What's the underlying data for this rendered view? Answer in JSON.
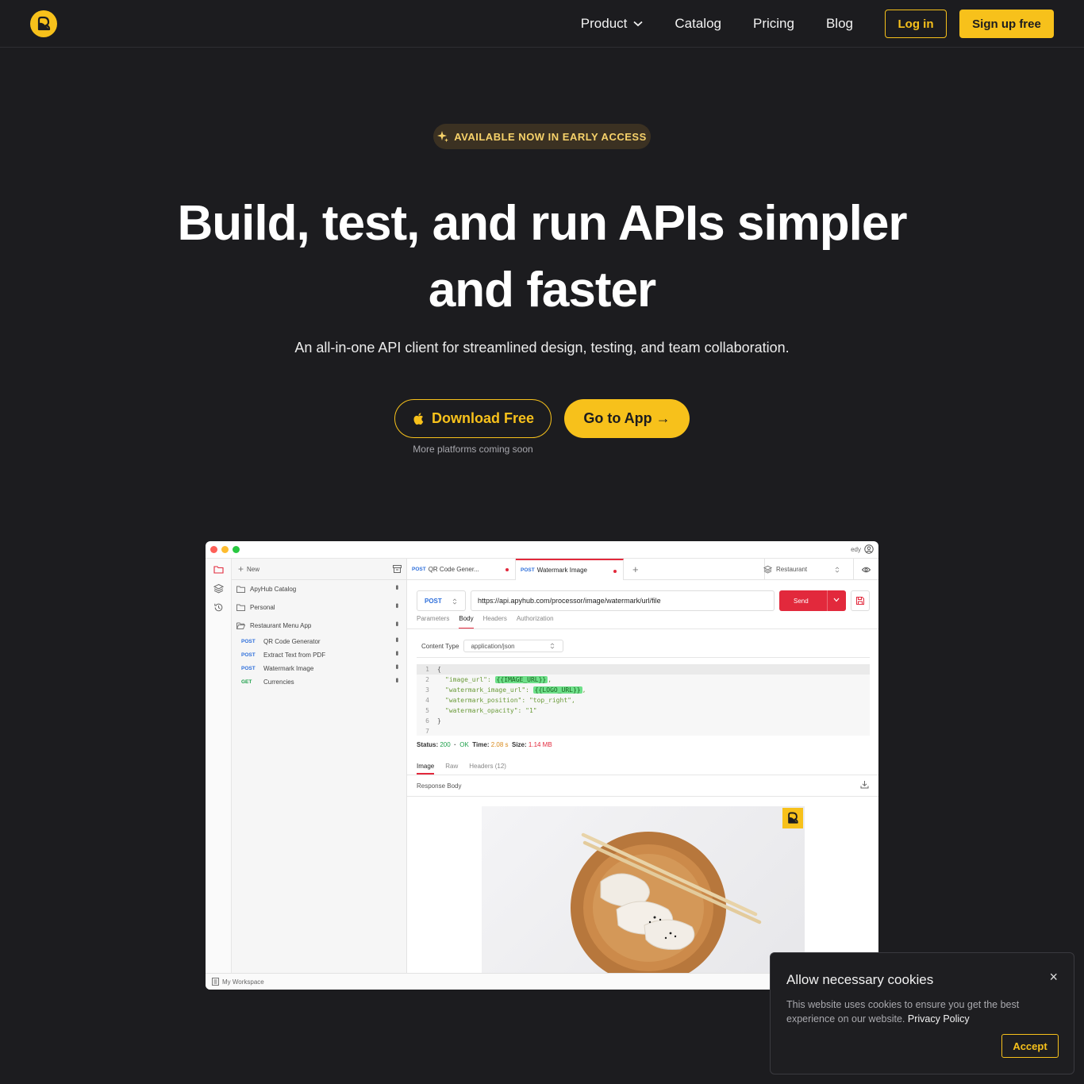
{
  "nav": {
    "links": [
      "Product",
      "Catalog",
      "Pricing",
      "Blog"
    ],
    "login": "Log in",
    "signup": "Sign up free"
  },
  "hero": {
    "badge": "AVAILABLE NOW IN EARLY ACCESS",
    "title_line1": "Build, test, and run APIs simpler",
    "title_line2": "and faster",
    "subtitle": "An all-in-one API client for streamlined design, testing, and team collaboration.",
    "download": "Download Free",
    "goto_app": "Go to App →",
    "more_platforms": "More platforms coming soon"
  },
  "app": {
    "user": "edy",
    "sidebar": {
      "new_label": "New",
      "folders": [
        "ApyHub Catalog",
        "Personal",
        "Restaurant Menu App"
      ],
      "requests": [
        {
          "method": "POST",
          "name": "QR Code Generator"
        },
        {
          "method": "POST",
          "name": "Extract Text from PDF"
        },
        {
          "method": "POST",
          "name": "Watermark Image"
        },
        {
          "method": "GET",
          "name": "Currencies"
        }
      ]
    },
    "tabs": [
      {
        "method": "POST",
        "name": "QR Code Gener..."
      },
      {
        "method": "POST",
        "name": "Watermark Image"
      }
    ],
    "environment": "Restaurant",
    "request": {
      "method": "POST",
      "url": "https://api.apyhub.com/processor/image/watermark/url/file",
      "send": "Send",
      "tabs": [
        "Parameters",
        "Body",
        "Headers",
        "Authorization"
      ],
      "content_type_label": "Content Type",
      "content_type": "application/json"
    },
    "code": {
      "l1": "{",
      "k2": "\"image_url\"",
      "v2": "{{IMAGE_URL}}",
      "k3": "\"watermark_image_url\"",
      "v3": "{{LOGO_URL}}",
      "k4": "\"watermark_position\"",
      "v4": "\"top_right\"",
      "k5": "\"watermark_opacity\"",
      "v5": "\"1\"",
      "l6": "}"
    },
    "response": {
      "status_label": "Status:",
      "status_code": "200",
      "status_text": "OK",
      "time_label": "Time:",
      "time": "2.08 s",
      "size_label": "Size:",
      "size": "1.14 MB",
      "tabs": [
        "Image",
        "Raw",
        "Headers (12)"
      ],
      "body_label": "Response Body"
    },
    "workspace": "My Workspace"
  },
  "cookie": {
    "title": "Allow necessary cookies",
    "text": "This website uses cookies to ensure you get the best experience on our website.",
    "policy": "Privacy Policy",
    "accept": "Accept",
    "close": "×"
  },
  "colors": {
    "accent": "#f7c11b",
    "background": "#1c1c1f",
    "send": "#e2293c"
  }
}
